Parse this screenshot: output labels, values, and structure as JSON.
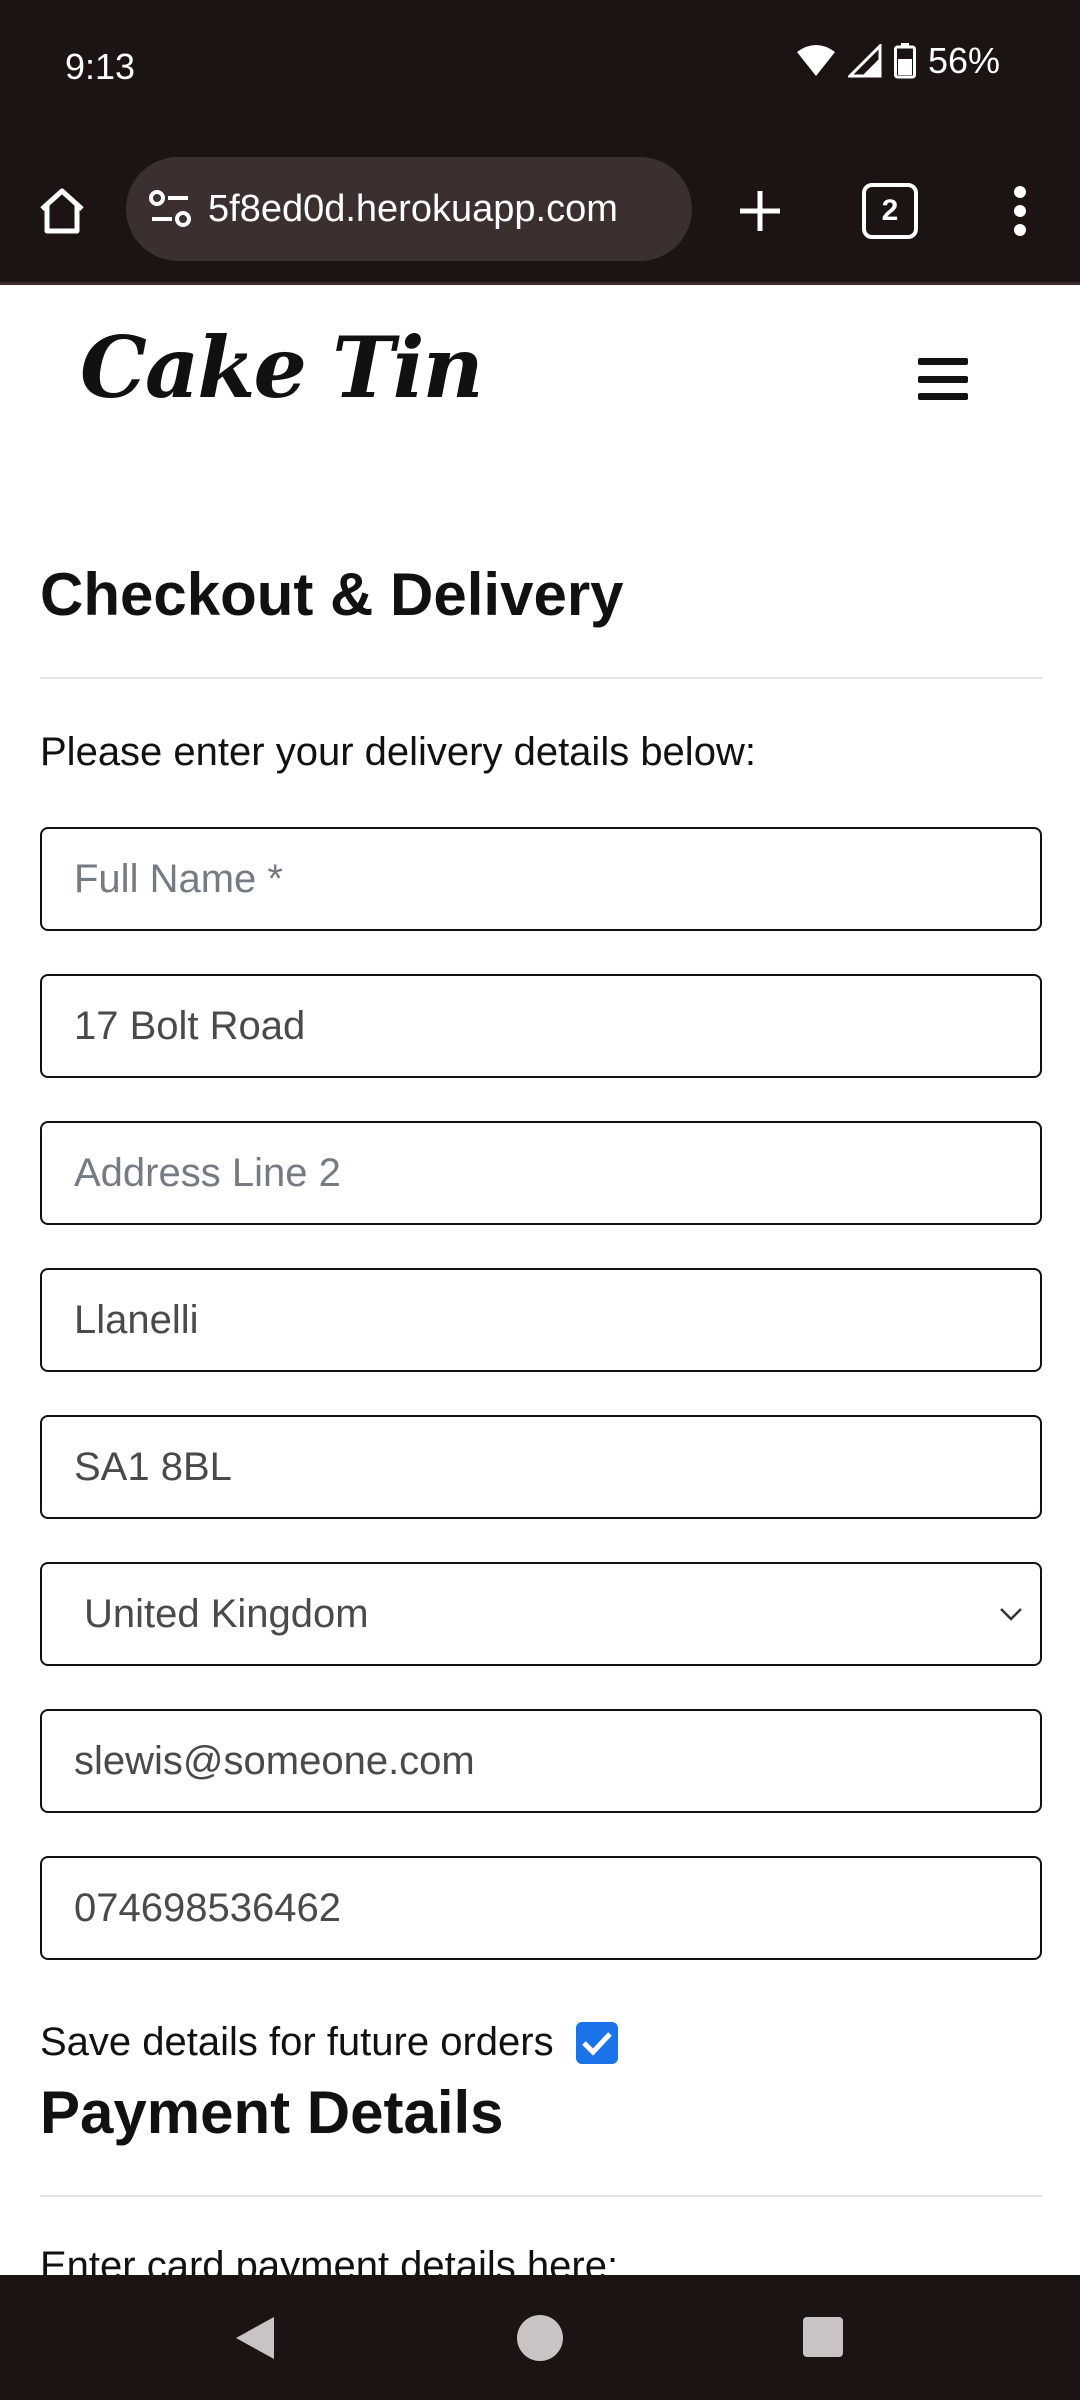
{
  "status_bar": {
    "time": "9:13",
    "battery": "56%",
    "icons": [
      "wifi-icon",
      "signal-icon",
      "battery-icon"
    ]
  },
  "browser": {
    "url": "5f8ed0d.herokuapp.com",
    "tab_count": "2",
    "icons": [
      "home-icon",
      "site-info-icon",
      "plus-icon",
      "more-vert-icon"
    ]
  },
  "header": {
    "logo": "Cake Tin"
  },
  "checkout": {
    "title": "Checkout & Delivery",
    "intro": "Please enter your delivery details below:",
    "fields": {
      "full_name_placeholder": "Full Name *",
      "address1_value": "17 Bolt Road",
      "address2_placeholder": "Address Line 2",
      "town_value": "Llanelli",
      "postcode_value": "SA1 8BL",
      "country_value": "United Kingdom",
      "email_value": "slewis@someone.com",
      "phone_value": "074698536462"
    },
    "save_label": "Save details for future orders",
    "save_checked": true
  },
  "payment": {
    "title": "Payment Details",
    "intro": "Enter card payment details here:"
  },
  "colors": {
    "system_bar": "#1c1313",
    "checkbox": "#1a73e8"
  }
}
